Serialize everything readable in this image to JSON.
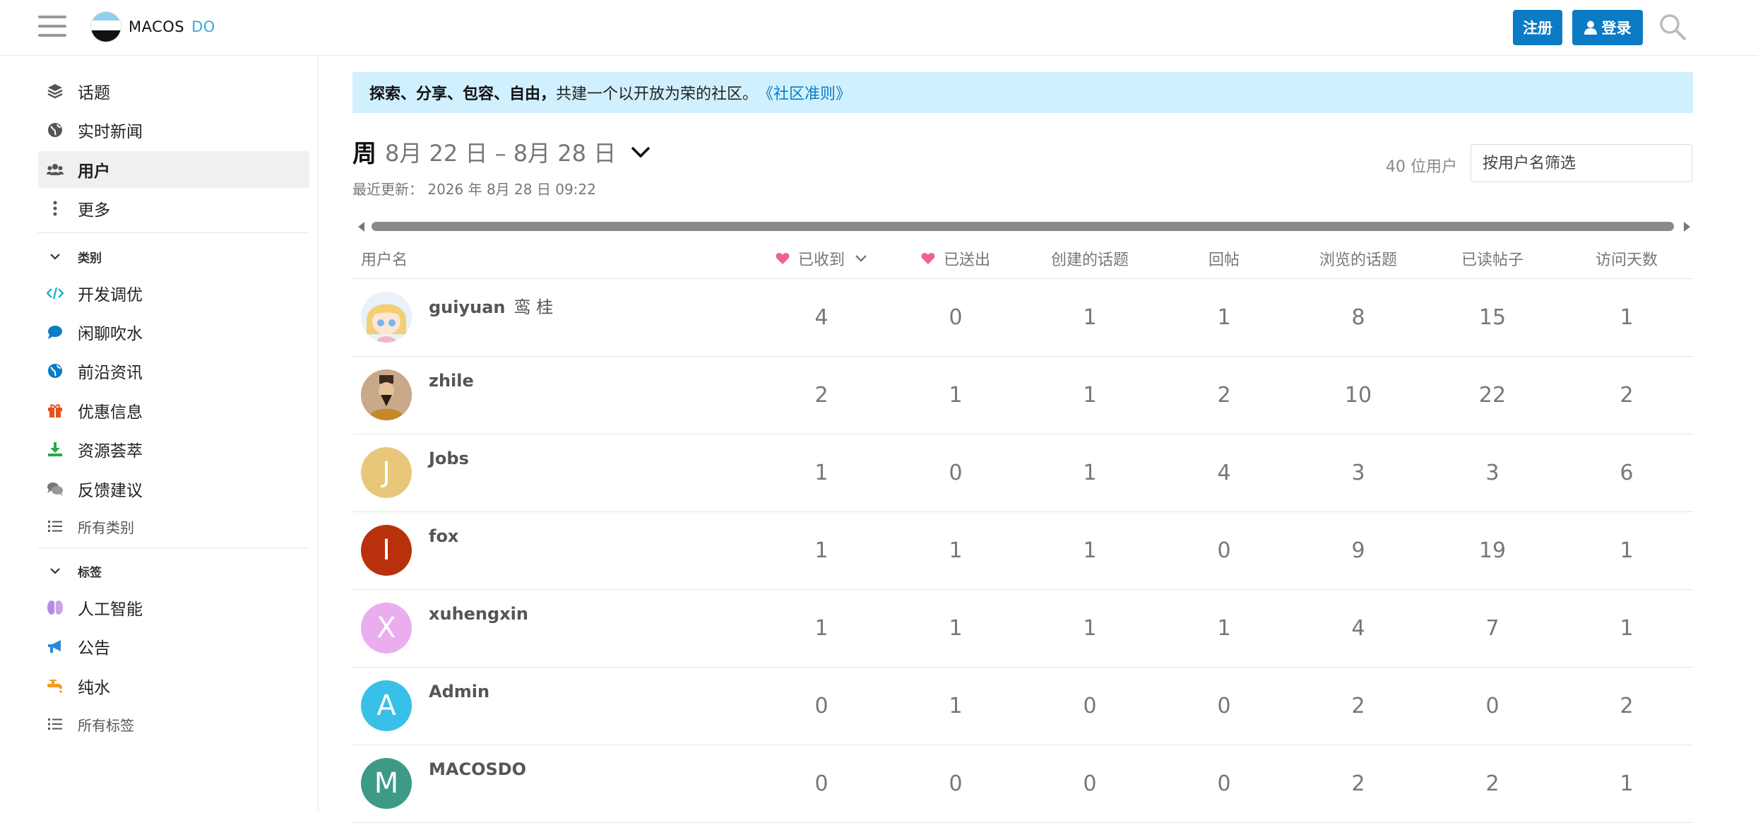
{
  "header": {
    "logo_main": "MACOS",
    "logo_accent": "DO",
    "register_label": "注册",
    "login_label": "登录"
  },
  "sidebar": {
    "items": [
      {
        "label": "话题",
        "icon": "layers-icon"
      },
      {
        "label": "实时新闻",
        "icon": "globe-icon"
      },
      {
        "label": "用户",
        "icon": "users-icon",
        "active": true
      },
      {
        "label": "更多",
        "icon": "more-vertical-icon"
      }
    ],
    "categories_heading": "类别",
    "categories": [
      {
        "label": "开发调优",
        "icon": "code-icon",
        "color": "#1ab4c8"
      },
      {
        "label": "闲聊吹水",
        "icon": "chat-bubble-icon",
        "color": "#0a7bc4"
      },
      {
        "label": "前沿资讯",
        "icon": "globe-icon",
        "color": "#0a7bc4"
      },
      {
        "label": "优惠信息",
        "icon": "gift-icon",
        "color": "#e4501e"
      },
      {
        "label": "资源荟萃",
        "icon": "download-icon",
        "color": "#2aa84a"
      },
      {
        "label": "反馈建议",
        "icon": "comments-icon",
        "color": "#777777"
      }
    ],
    "all_categories_label": "所有类别",
    "tags_heading": "标签",
    "tags": [
      {
        "label": "人工智能",
        "icon": "brain-icon",
        "color": "#b58ce0"
      },
      {
        "label": "公告",
        "icon": "megaphone-icon",
        "color": "#2f88d6"
      },
      {
        "label": "纯水",
        "icon": "faucet-icon",
        "color": "#f0a020"
      }
    ],
    "all_tags_label": "所有标签"
  },
  "banner": {
    "bold": "探索、分享、包容、自由，",
    "text": "共建一个以开放为荣的社区。",
    "link": "《社区准则》"
  },
  "period": {
    "label": "周",
    "range": "8月 22 日 – 8月 28 日",
    "updated": "最近更新： 2026 年 8月 28 日 09:22"
  },
  "filter": {
    "user_count": "40 位用户",
    "placeholder": "按用户名筛选"
  },
  "table": {
    "headers": [
      "用户名",
      "已收到",
      "已送出",
      "创建的话题",
      "回帖",
      "浏览的话题",
      "已读帖子",
      "访问天数"
    ],
    "rows": [
      {
        "username": "guiyuan",
        "realname": "鸾 桂",
        "avatar": "",
        "avatar_color": "#d8e6f5",
        "values": [
          "4",
          "0",
          "1",
          "1",
          "8",
          "15",
          "1"
        ]
      },
      {
        "username": "zhile",
        "realname": "",
        "avatar": "",
        "avatar_color": "#8a6a4a",
        "values": [
          "2",
          "1",
          "1",
          "2",
          "10",
          "22",
          "2"
        ]
      },
      {
        "username": "Jobs",
        "realname": "",
        "avatar": "J",
        "avatar_color": "#e8c77b",
        "values": [
          "1",
          "0",
          "1",
          "4",
          "3",
          "3",
          "6"
        ]
      },
      {
        "username": "fox",
        "realname": "",
        "avatar": "I",
        "avatar_color": "#b9300c",
        "values": [
          "1",
          "1",
          "1",
          "0",
          "9",
          "19",
          "1"
        ]
      },
      {
        "username": "xuhengxin",
        "realname": "",
        "avatar": "X",
        "avatar_color": "#eaaef0",
        "values": [
          "1",
          "1",
          "1",
          "1",
          "4",
          "7",
          "1"
        ]
      },
      {
        "username": "Admin",
        "realname": "",
        "avatar": "A",
        "avatar_color": "#38c0e8",
        "values": [
          "0",
          "1",
          "0",
          "0",
          "2",
          "0",
          "2"
        ]
      },
      {
        "username": "MACOSDO",
        "realname": "",
        "avatar": "M",
        "avatar_color": "#3c9a86",
        "values": [
          "0",
          "0",
          "0",
          "0",
          "2",
          "2",
          "1"
        ]
      }
    ]
  }
}
